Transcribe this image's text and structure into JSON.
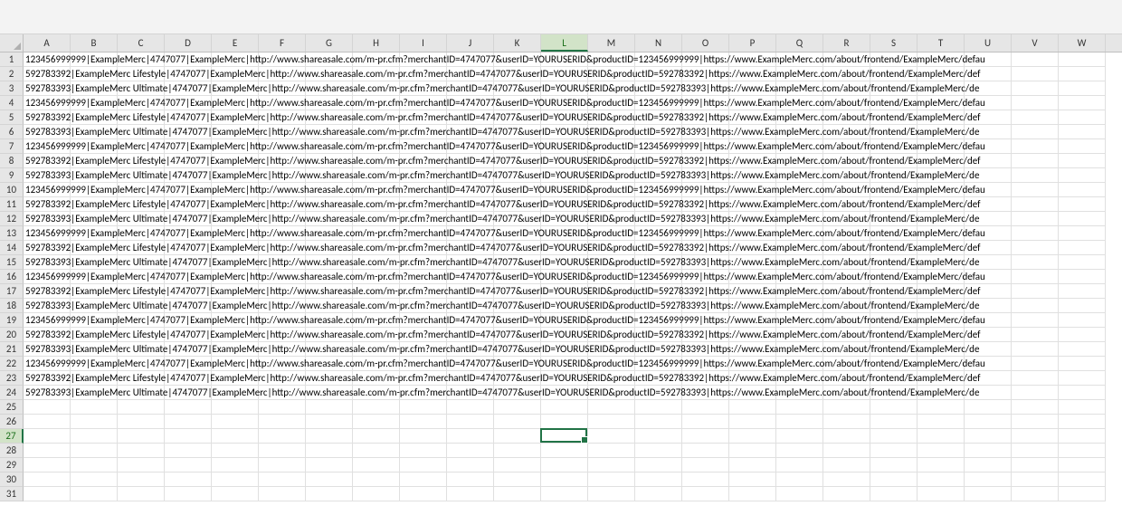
{
  "active_cell": {
    "col_index": 11,
    "row_index": 26
  },
  "columns": [
    "A",
    "B",
    "C",
    "D",
    "E",
    "F",
    "G",
    "H",
    "I",
    "J",
    "K",
    "L",
    "M",
    "N",
    "O",
    "P",
    "Q",
    "R",
    "S",
    "T",
    "U",
    "V",
    "W"
  ],
  "total_rows_visible": 31,
  "product_rows": [
    {
      "id": "123456999999",
      "name": "ExampleMerc",
      "merchant_id": "4747077",
      "merchant": "ExampleMerc",
      "url": "http://www.shareasale.com/m-pr.cfm?merchantID=4747077&userID=YOURUSERID&productID=123456999999",
      "https_url": "https://www.ExampleMerc.com/about/frontend/ExampleMerc/defau"
    },
    {
      "id": "592783392",
      "name": "ExampleMerc Lifestyle",
      "merchant_id": "4747077",
      "merchant": "ExampleMerc",
      "url": "http://www.shareasale.com/m-pr.cfm?merchantID=4747077&userID=YOURUSERID&productID=592783392",
      "https_url": "https://www.ExampleMerc.com/about/frontend/ExampleMerc/def"
    },
    {
      "id": "592783393",
      "name": "ExampleMerc Ultimate",
      "merchant_id": "4747077",
      "merchant": "ExampleMerc",
      "url": "http://www.shareasale.com/m-pr.cfm?merchantID=4747077&userID=YOURUSERID&productID=592783393",
      "https_url": "https://www.ExampleMerc.com/about/frontend/ExampleMerc/de"
    },
    {
      "id": "123456999999",
      "name": "ExampleMerc",
      "merchant_id": "4747077",
      "merchant": "ExampleMerc",
      "url": "http://www.shareasale.com/m-pr.cfm?merchantID=4747077&userID=YOURUSERID&productID=123456999999",
      "https_url": "https://www.ExampleMerc.com/about/frontend/ExampleMerc/defau"
    },
    {
      "id": "592783392",
      "name": "ExampleMerc Lifestyle",
      "merchant_id": "4747077",
      "merchant": "ExampleMerc",
      "url": "http://www.shareasale.com/m-pr.cfm?merchantID=4747077&userID=YOURUSERID&productID=592783392",
      "https_url": "https://www.ExampleMerc.com/about/frontend/ExampleMerc/def"
    },
    {
      "id": "592783393",
      "name": "ExampleMerc Ultimate",
      "merchant_id": "4747077",
      "merchant": "ExampleMerc",
      "url": "http://www.shareasale.com/m-pr.cfm?merchantID=4747077&userID=YOURUSERID&productID=592783393",
      "https_url": "https://www.ExampleMerc.com/about/frontend/ExampleMerc/de"
    },
    {
      "id": "123456999999",
      "name": "ExampleMerc",
      "merchant_id": "4747077",
      "merchant": "ExampleMerc",
      "url": "http://www.shareasale.com/m-pr.cfm?merchantID=4747077&userID=YOURUSERID&productID=123456999999",
      "https_url": "https://www.ExampleMerc.com/about/frontend/ExampleMerc/defau"
    },
    {
      "id": "592783392",
      "name": "ExampleMerc Lifestyle",
      "merchant_id": "4747077",
      "merchant": "ExampleMerc",
      "url": "http://www.shareasale.com/m-pr.cfm?merchantID=4747077&userID=YOURUSERID&productID=592783392",
      "https_url": "https://www.ExampleMerc.com/about/frontend/ExampleMerc/def"
    },
    {
      "id": "592783393",
      "name": "ExampleMerc Ultimate",
      "merchant_id": "4747077",
      "merchant": "ExampleMerc",
      "url": "http://www.shareasale.com/m-pr.cfm?merchantID=4747077&userID=YOURUSERID&productID=592783393",
      "https_url": "https://www.ExampleMerc.com/about/frontend/ExampleMerc/de"
    },
    {
      "id": "123456999999",
      "name": "ExampleMerc",
      "merchant_id": "4747077",
      "merchant": "ExampleMerc",
      "url": "http://www.shareasale.com/m-pr.cfm?merchantID=4747077&userID=YOURUSERID&productID=123456999999",
      "https_url": "https://www.ExampleMerc.com/about/frontend/ExampleMerc/defau"
    },
    {
      "id": "592783392",
      "name": "ExampleMerc Lifestyle",
      "merchant_id": "4747077",
      "merchant": "ExampleMerc",
      "url": "http://www.shareasale.com/m-pr.cfm?merchantID=4747077&userID=YOURUSERID&productID=592783392",
      "https_url": "https://www.ExampleMerc.com/about/frontend/ExampleMerc/def"
    },
    {
      "id": "592783393",
      "name": "ExampleMerc Ultimate",
      "merchant_id": "4747077",
      "merchant": "ExampleMerc",
      "url": "http://www.shareasale.com/m-pr.cfm?merchantID=4747077&userID=YOURUSERID&productID=592783393",
      "https_url": "https://www.ExampleMerc.com/about/frontend/ExampleMerc/de"
    },
    {
      "id": "123456999999",
      "name": "ExampleMerc",
      "merchant_id": "4747077",
      "merchant": "ExampleMerc",
      "url": "http://www.shareasale.com/m-pr.cfm?merchantID=4747077&userID=YOURUSERID&productID=123456999999",
      "https_url": "https://www.ExampleMerc.com/about/frontend/ExampleMerc/defau"
    },
    {
      "id": "592783392",
      "name": "ExampleMerc Lifestyle",
      "merchant_id": "4747077",
      "merchant": "ExampleMerc",
      "url": "http://www.shareasale.com/m-pr.cfm?merchantID=4747077&userID=YOURUSERID&productID=592783392",
      "https_url": "https://www.ExampleMerc.com/about/frontend/ExampleMerc/def"
    },
    {
      "id": "592783393",
      "name": "ExampleMerc Ultimate",
      "merchant_id": "4747077",
      "merchant": "ExampleMerc",
      "url": "http://www.shareasale.com/m-pr.cfm?merchantID=4747077&userID=YOURUSERID&productID=592783393",
      "https_url": "https://www.ExampleMerc.com/about/frontend/ExampleMerc/de"
    },
    {
      "id": "123456999999",
      "name": "ExampleMerc",
      "merchant_id": "4747077",
      "merchant": "ExampleMerc",
      "url": "http://www.shareasale.com/m-pr.cfm?merchantID=4747077&userID=YOURUSERID&productID=123456999999",
      "https_url": "https://www.ExampleMerc.com/about/frontend/ExampleMerc/defau"
    },
    {
      "id": "592783392",
      "name": "ExampleMerc Lifestyle",
      "merchant_id": "4747077",
      "merchant": "ExampleMerc",
      "url": "http://www.shareasale.com/m-pr.cfm?merchantID=4747077&userID=YOURUSERID&productID=592783392",
      "https_url": "https://www.ExampleMerc.com/about/frontend/ExampleMerc/def"
    },
    {
      "id": "592783393",
      "name": "ExampleMerc Ultimate",
      "merchant_id": "4747077",
      "merchant": "ExampleMerc",
      "url": "http://www.shareasale.com/m-pr.cfm?merchantID=4747077&userID=YOURUSERID&productID=592783393",
      "https_url": "https://www.ExampleMerc.com/about/frontend/ExampleMerc/de"
    },
    {
      "id": "123456999999",
      "name": "ExampleMerc",
      "merchant_id": "4747077",
      "merchant": "ExampleMerc",
      "url": "http://www.shareasale.com/m-pr.cfm?merchantID=4747077&userID=YOURUSERID&productID=123456999999",
      "https_url": "https://www.ExampleMerc.com/about/frontend/ExampleMerc/defau"
    },
    {
      "id": "592783392",
      "name": "ExampleMerc Lifestyle",
      "merchant_id": "4747077",
      "merchant": "ExampleMerc",
      "url": "http://www.shareasale.com/m-pr.cfm?merchantID=4747077&userID=YOURUSERID&productID=592783392",
      "https_url": "https://www.ExampleMerc.com/about/frontend/ExampleMerc/def"
    },
    {
      "id": "592783393",
      "name": "ExampleMerc Ultimate",
      "merchant_id": "4747077",
      "merchant": "ExampleMerc",
      "url": "http://www.shareasale.com/m-pr.cfm?merchantID=4747077&userID=YOURUSERID&productID=592783393",
      "https_url": "https://www.ExampleMerc.com/about/frontend/ExampleMerc/de"
    },
    {
      "id": "123456999999",
      "name": "ExampleMerc",
      "merchant_id": "4747077",
      "merchant": "ExampleMerc",
      "url": "http://www.shareasale.com/m-pr.cfm?merchantID=4747077&userID=YOURUSERID&productID=123456999999",
      "https_url": "https://www.ExampleMerc.com/about/frontend/ExampleMerc/defau"
    },
    {
      "id": "592783392",
      "name": "ExampleMerc Lifestyle",
      "merchant_id": "4747077",
      "merchant": "ExampleMerc",
      "url": "http://www.shareasale.com/m-pr.cfm?merchantID=4747077&userID=YOURUSERID&productID=592783392",
      "https_url": "https://www.ExampleMerc.com/about/frontend/ExampleMerc/def"
    },
    {
      "id": "592783393",
      "name": "ExampleMerc Ultimate",
      "merchant_id": "4747077",
      "merchant": "ExampleMerc",
      "url": "http://www.shareasale.com/m-pr.cfm?merchantID=4747077&userID=YOURUSERID&productID=592783393",
      "https_url": "https://www.ExampleMerc.com/about/frontend/ExampleMerc/de"
    }
  ]
}
